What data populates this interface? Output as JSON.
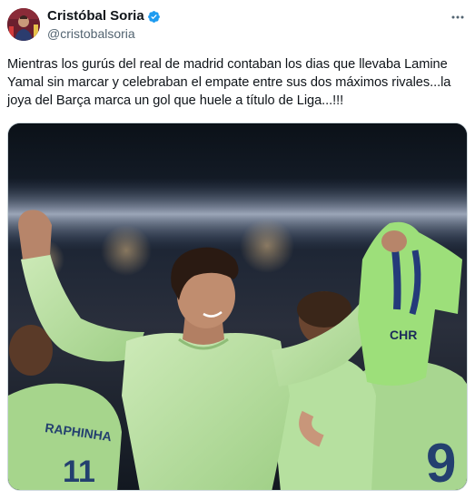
{
  "author": {
    "display_name": "Cristóbal Soria",
    "handle": "@cristobalsoria",
    "verified": true,
    "verified_color": "#1d9bf0",
    "avatar_icon": "profile-photo"
  },
  "menu": {
    "icon": "more-horizontal-icon"
  },
  "tweet": {
    "text": "Mientras los gurús del real de madrid contaban los dias que llevaba Lamine Yamal sin marcar y celebraban el empate entre sus dos máximos rivales...la joya del Barça marca un gol que huele a título de Liga...!!!"
  },
  "media": {
    "jersey_text_back": "RAPHINHA",
    "jersey_number_back": "11",
    "jersey_number_right": "9",
    "shirt_sponsor": "CHR",
    "jersey_color": "#b9e8a3"
  }
}
